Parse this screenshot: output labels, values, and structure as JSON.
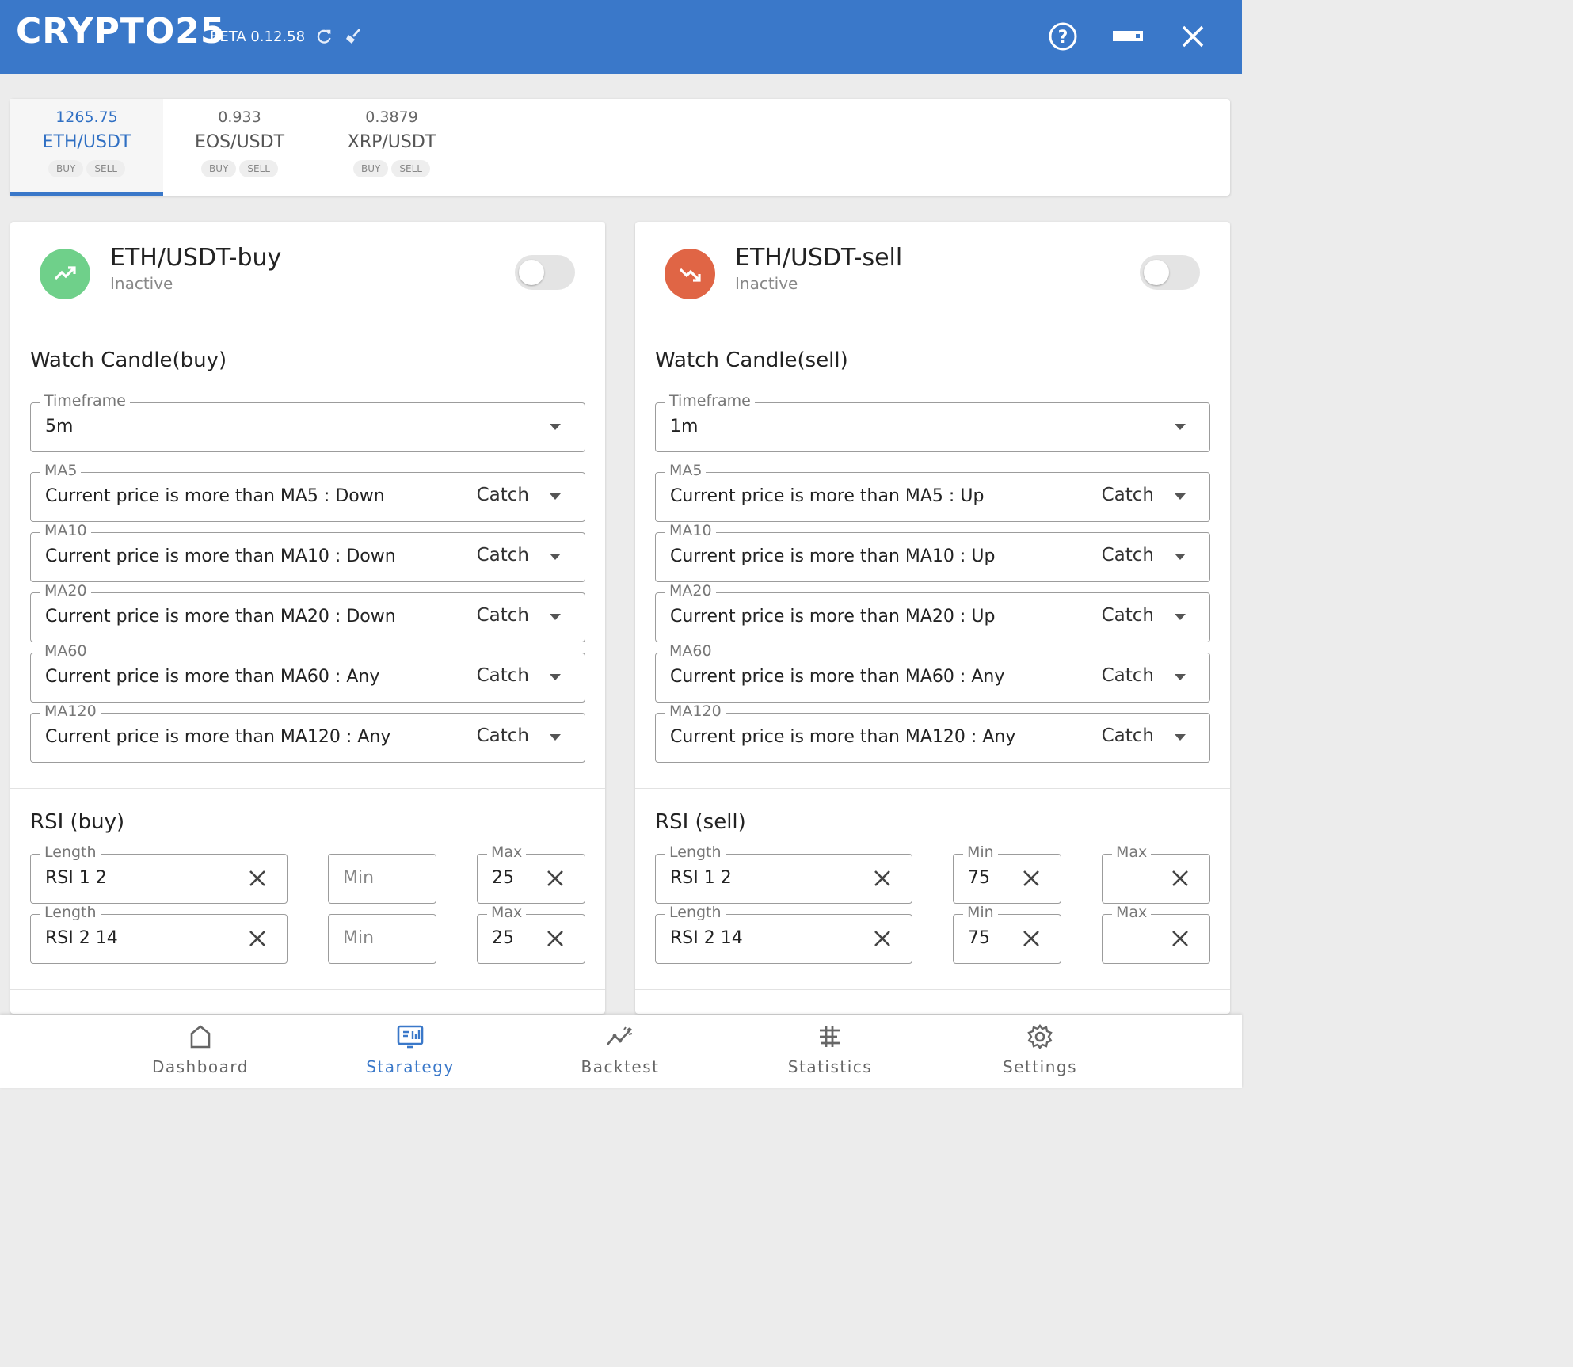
{
  "app": {
    "name": "CRYPTO25",
    "version": "BETA 0.12.58"
  },
  "window": {
    "help_icon": "help-circle-icon",
    "minimize_icon": "minimize-icon",
    "close_icon": "close-icon"
  },
  "pairs": [
    {
      "price": "1265.75",
      "name": "ETH/USDT",
      "buy": "BUY",
      "sell": "SELL",
      "active": true
    },
    {
      "price": "0.933",
      "name": "EOS/USDT",
      "buy": "BUY",
      "sell": "SELL",
      "active": false
    },
    {
      "price": "0.3879",
      "name": "XRP/USDT",
      "buy": "BUY",
      "sell": "SELL",
      "active": false
    }
  ],
  "buy_panel": {
    "title": "ETH/USDT-buy",
    "status": "Inactive",
    "icon": "trending-up-icon",
    "accent": "#6fd08a",
    "candle_title": "Watch Candle(buy)",
    "timeframe": {
      "label": "Timeframe",
      "value": "5m"
    },
    "ma": [
      {
        "label": "MA5",
        "text": "Current price is more than MA5 :",
        "dir": "Down",
        "mode": "Catch"
      },
      {
        "label": "MA10",
        "text": "Current price is more than MA10 :",
        "dir": "Down",
        "mode": "Catch"
      },
      {
        "label": "MA20",
        "text": "Current price is more than MA20 :",
        "dir": "Down",
        "mode": "Catch"
      },
      {
        "label": "MA60",
        "text": "Current price is more than MA60 :",
        "dir": "Any",
        "mode": "Catch"
      },
      {
        "label": "MA120",
        "text": "Current price is more than MA120 :",
        "dir": "Any",
        "mode": "Catch"
      }
    ],
    "rsi_title": "RSI (buy)",
    "rsi": [
      {
        "length_label": "Length",
        "length": "RSI 1 2",
        "min_placeholder": "Min",
        "max_label": "Max",
        "max": "25"
      },
      {
        "length_label": "Length",
        "length": "RSI 2 14",
        "min_placeholder": "Min",
        "max_label": "Max",
        "max": "25"
      }
    ]
  },
  "sell_panel": {
    "title": "ETH/USDT-sell",
    "status": "Inactive",
    "icon": "trending-down-icon",
    "accent": "#e06545",
    "candle_title": "Watch Candle(sell)",
    "timeframe": {
      "label": "Timeframe",
      "value": "1m"
    },
    "ma": [
      {
        "label": "MA5",
        "text": "Current price is more than MA5 :",
        "dir": "Up",
        "mode": "Catch"
      },
      {
        "label": "MA10",
        "text": "Current price is more than MA10 :",
        "dir": "Up",
        "mode": "Catch"
      },
      {
        "label": "MA20",
        "text": "Current price is more than MA20 :",
        "dir": "Up",
        "mode": "Catch"
      },
      {
        "label": "MA60",
        "text": "Current price is more than MA60 :",
        "dir": "Any",
        "mode": "Catch"
      },
      {
        "label": "MA120",
        "text": "Current price is more than MA120 :",
        "dir": "Any",
        "mode": "Catch"
      }
    ],
    "rsi_title": "RSI (sell)",
    "rsi": [
      {
        "length_label": "Length",
        "length": "RSI 1 2",
        "min_label": "Min",
        "min": "75",
        "max_label": "Max"
      },
      {
        "length_label": "Length",
        "length": "RSI 2 14",
        "min_label": "Min",
        "min": "75",
        "max_label": "Max"
      }
    ]
  },
  "nav": [
    {
      "label": "Dashboard",
      "icon": "home-icon",
      "active": false
    },
    {
      "label": "Starategy",
      "icon": "strategy-icon",
      "active": true
    },
    {
      "label": "Backtest",
      "icon": "chart-line-icon",
      "active": false
    },
    {
      "label": "Statistics",
      "icon": "statistics-icon",
      "active": false
    },
    {
      "label": "Settings",
      "icon": "gear-icon",
      "active": false
    }
  ],
  "colors": {
    "primary": "#3a78c9",
    "buy": "#6fd08a",
    "sell": "#e06545"
  }
}
